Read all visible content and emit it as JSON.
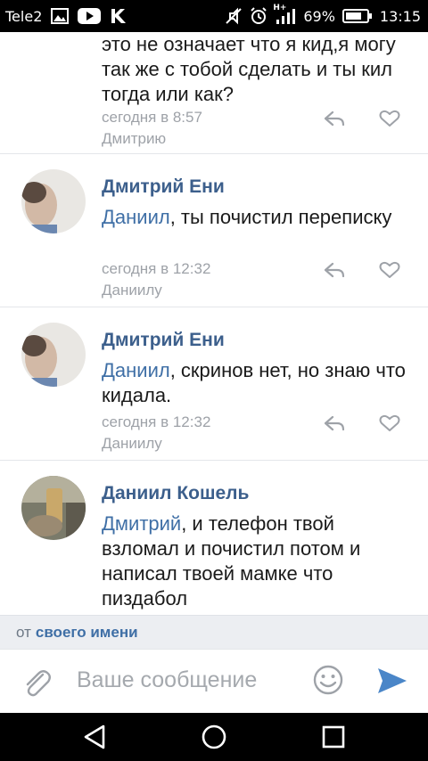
{
  "status_bar": {
    "carrier": "Tele2",
    "network": "H+",
    "battery": "69%",
    "time": "13:15",
    "icons": [
      "gallery-icon",
      "youtube-icon",
      "vk-icon",
      "mute-icon",
      "alarm-icon",
      "signal-icon",
      "battery-icon"
    ]
  },
  "comments": [
    {
      "author": "",
      "mention": "",
      "text": "это не означает что я кид,я могу так же с тобой сделать и ты кил тогда или как?",
      "date": "сегодня в 8:57",
      "reply_to": "Дмитрию"
    },
    {
      "author": "Дмитрий Ени",
      "mention": "Даниил",
      "text": ", ты почистил переписку",
      "date": "сегодня в 12:32",
      "reply_to": "Даниилу"
    },
    {
      "author": "Дмитрий Ени",
      "mention": "Даниил",
      "text": ", скринов нет, но знаю что кидала.",
      "date": "сегодня в 12:32",
      "reply_to": "Даниилу"
    },
    {
      "author": "Даниил Кошель",
      "mention": "Дмитрий",
      "text": ", и телефон твой взломал и почистил потом и написал твоей мамке что пиздабол",
      "date": "",
      "reply_to": ""
    }
  ],
  "reply_as": {
    "prefix": "от",
    "link": "своего имени"
  },
  "composer": {
    "placeholder": "Ваше сообщение",
    "icons": [
      "attach-icon",
      "emoji-icon",
      "send-icon"
    ]
  },
  "colors": {
    "accent": "#3f6fa6",
    "author": "#3c5f8c",
    "meta": "#9ea2a8",
    "send": "#4a86c8"
  }
}
